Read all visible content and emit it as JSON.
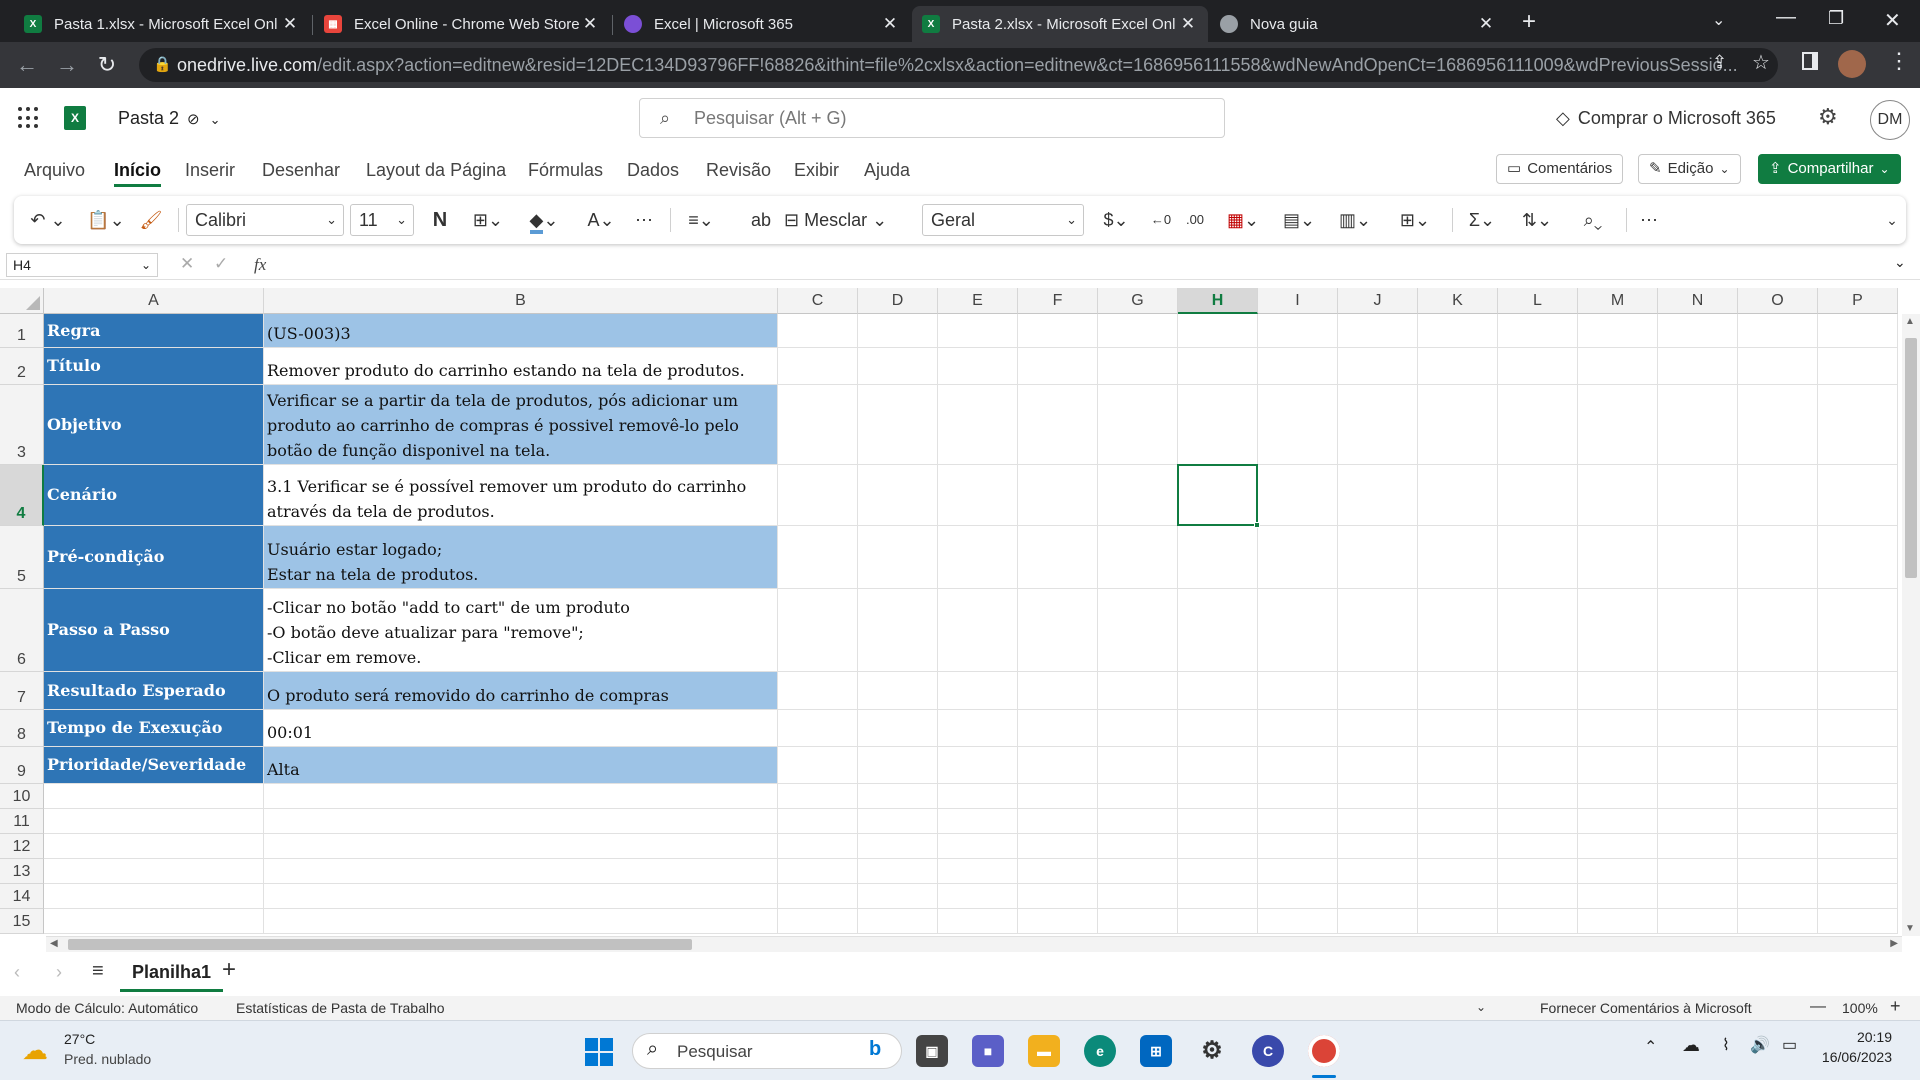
{
  "browser": {
    "tabs": [
      {
        "title": "Pasta 1.xlsx - Microsoft Excel Onl",
        "favicon": "excel-icon",
        "active": false
      },
      {
        "title": "Excel Online - Chrome Web Store",
        "favicon": "chrome-web-store-icon",
        "active": false
      },
      {
        "title": "Excel | Microsoft 365",
        "favicon": "microsoft-365-icon",
        "active": false
      },
      {
        "title": "Pasta 2.xlsx - Microsoft Excel Onl",
        "favicon": "excel-icon",
        "active": true
      },
      {
        "title": "Nova guia",
        "favicon": "chrome-icon",
        "active": false
      }
    ],
    "url_host": "onedrive.live.com",
    "url_path": "/edit.aspx?action=editnew&resid=12DEC134D93796FF!68826&ithint=file%2cxlsx&action=editnew&ct=1686956111558&wdNewAndOpenCt=1686956111009&wdPreviousSessio..."
  },
  "excel": {
    "doc_name": "Pasta 2",
    "search_placeholder": "Pesquisar (Alt + G)",
    "buy_label": "Comprar o Microsoft 365",
    "avatar_initials": "DM",
    "menu": [
      "Arquivo",
      "Início",
      "Inserir",
      "Desenhar",
      "Layout da Página",
      "Fórmulas",
      "Dados",
      "Revisão",
      "Exibir",
      "Ajuda"
    ],
    "active_menu": "Início",
    "comments_label": "Comentários",
    "editing_label": "Edição",
    "share_label": "Compartilhar",
    "font_name": "Calibri",
    "font_size": "11",
    "bold_glyph": "N",
    "merge_label": "Mesclar",
    "number_format": "Geral",
    "name_box": "H4",
    "fx_label": "fx",
    "formula_value": ""
  },
  "sheet": {
    "columns": [
      "A",
      "B",
      "C",
      "D",
      "E",
      "F",
      "G",
      "H",
      "I",
      "J",
      "K",
      "L",
      "M",
      "N",
      "O",
      "P"
    ],
    "selected_column": "H",
    "selected_row": 4,
    "rows": [
      {
        "n": "1",
        "label": "Regra",
        "value": "(US-003)3",
        "blue": true
      },
      {
        "n": "2",
        "label": "Título",
        "value": "Remover produto do carrinho estando na tela de produtos.",
        "blue": false
      },
      {
        "n": "3",
        "label": "Objetivo",
        "value": "Verificar se a partir da tela de produtos, pós adicionar um\nproduto ao carrinho de compras é possivel removê-lo pelo\nbotão de função disponivel na tela.",
        "blue": true
      },
      {
        "n": "4",
        "label": "Cenário",
        "value": "3.1 Verificar se é possível remover um produto do carrinho\natravés da tela de produtos.",
        "blue": false
      },
      {
        "n": "5",
        "label": "Pré-condição",
        "value": "Usuário estar logado;\nEstar na tela de produtos.",
        "blue": true
      },
      {
        "n": "6",
        "label": "Passo a Passo",
        "value": "-Clicar no botão \"add to cart\" de um produto\n-O botão deve atualizar para \"remove\";\n-Clicar em remove.",
        "blue": false
      },
      {
        "n": "7",
        "label": "Resultado Esperado",
        "value": "O produto será removido do carrinho de compras",
        "blue": true
      },
      {
        "n": "8",
        "label": "Tempo de Exexução",
        "value": "00:01",
        "blue": false
      },
      {
        "n": "9",
        "label": "Prioridade/Severidade",
        "value": "Alta",
        "blue": true
      }
    ],
    "empty_rows": [
      "10",
      "11",
      "12",
      "13",
      "14",
      "15"
    ],
    "sheet_tab": "Planilha1"
  },
  "status": {
    "calc_mode": "Modo de Cálculo: Automático",
    "workbook_stats": "Estatísticas de Pasta de Trabalho",
    "feedback": "Fornecer Comentários à Microsoft",
    "zoom": "100%"
  },
  "taskbar": {
    "weather_temp": "27°C",
    "weather_desc": "Pred. nublado",
    "search_label": "Pesquisar",
    "time": "20:19",
    "date": "16/06/2023"
  }
}
